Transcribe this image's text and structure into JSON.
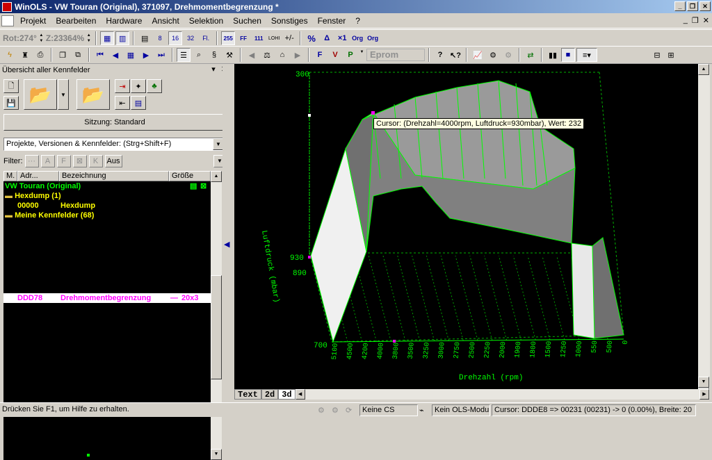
{
  "window": {
    "title": "WinOLS - VW Touran (Original), 371097, Drehmomentbegrenzung *"
  },
  "menu": [
    "Projekt",
    "Bearbeiten",
    "Hardware",
    "Ansicht",
    "Selektion",
    "Suchen",
    "Sonstiges",
    "Fenster",
    "?"
  ],
  "toolbar": {
    "rotation": "Rot:274°",
    "zoom": "Z:23364%",
    "eprom": "Eprom",
    "icons": [
      "view-2d-icon",
      "view-cols-icon",
      "grid-icon",
      "bit8-icon",
      "bit16-icon",
      "bit32-icon",
      "float-icon",
      "hex255-icon",
      "hexff-icon",
      "dec111-icon",
      "lohi-icon",
      "sign-icon",
      "percent-icon",
      "delta-icon",
      "x1-icon",
      "org-icon",
      "org2-icon"
    ]
  },
  "panel": {
    "title": "Übersicht aller Kennfelder",
    "session_button": "Sitzung: Standard",
    "search_combo": "Projekte, Versionen & Kennfelder: (Strg+Shift+F)",
    "filter_label": "Filter:",
    "aus_button": "Aus",
    "columns": [
      "M.",
      "Adr...",
      "Bezeichnung",
      "Größe"
    ],
    "rows": [
      {
        "addr": "VW Touran (Original)",
        "name": "",
        "size": "",
        "color": "#00ff00",
        "kind": "project"
      },
      {
        "addr": "Hexdump (1)",
        "name": "",
        "size": "",
        "color": "#ffff00",
        "kind": "folder"
      },
      {
        "addr": "00000",
        "name": "Hexdump",
        "size": "",
        "color": "#ffff00",
        "kind": "item"
      },
      {
        "addr": "Meine Kennfelder (68)",
        "name": "",
        "size": "",
        "color": "#ffff00",
        "kind": "folder"
      },
      {
        "addr": "DDD78",
        "name": "Drehmomentbegrenzung",
        "size": "20x3",
        "color": "#ff00ff",
        "kind": "selected"
      }
    ]
  },
  "chart": {
    "xlabel": "Drehzahl (rpm)",
    "ylabel": "Luftdruck (mbar)",
    "z_ticks": [
      "300",
      "930",
      "890",
      "700"
    ],
    "x_ticks": [
      "5100",
      "4500",
      "4200",
      "4000",
      "3800",
      "3500",
      "3250",
      "3000",
      "2750",
      "2500",
      "2250",
      "2000",
      "1900",
      "1800",
      "1500",
      "1250",
      "1000",
      "550",
      "500",
      "0"
    ],
    "tooltip": "Cursor: (Drehzahl=4000rpm, Luftdruck=930mbar), Wert: 232"
  },
  "tabs": [
    "Text",
    "2d",
    "3d"
  ],
  "status": {
    "help": "Drücken Sie F1, um Hilfe zu erhalten.",
    "cs": "Keine CS",
    "ols": "Kein OLS-Modul",
    "cursor": "Cursor: DDDE8 => 00231 (00231) -> 0 (0.00%), Breite: 20"
  },
  "colors": {
    "grid": "#00ff00",
    "plot_bg": "#000000",
    "selection": "#ff00ff",
    "title_bar": "#0a246a"
  }
}
